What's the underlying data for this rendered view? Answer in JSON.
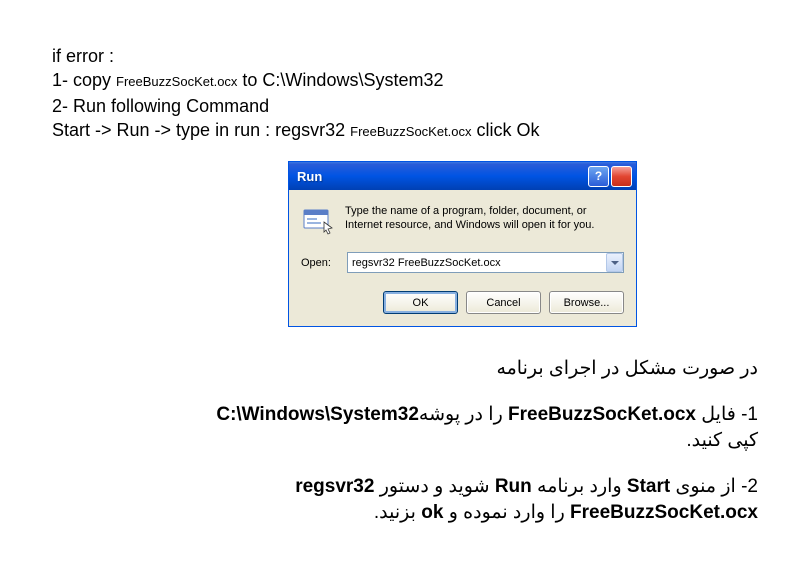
{
  "english": {
    "line1": "if error :",
    "line2a": "1- copy ",
    "line2b": "FreeBuzzSocKet.ocx",
    "line2c": " to  C:\\Windows\\System32",
    "line3": "2- Run following Command",
    "line4a": "Start -> Run -> type in run :  regsvr32 ",
    "line4b": "FreeBuzzSocKet.ocx",
    "line4c": "   click Ok"
  },
  "dialog": {
    "title": "Run",
    "description": "Type the name of a program, folder, document, or Internet resource, and Windows will open it for you.",
    "open_label": "Open:",
    "input_value": "regsvr32  FreeBuzzSocKet.ocx",
    "ok_label": "OK",
    "cancel_label": "Cancel",
    "browse_label": "Browse..."
  },
  "farsi": {
    "p1": "در صورت مشکل در اجرای برنامه",
    "p2_a": "1- فایل ",
    "p2_file": "FreeBuzzSocKet.ocx",
    "p2_b": " را در پوشه",
    "p2_path": "C:\\Windows\\System32",
    "p2_c": " کپی کنید.",
    "p3_a": "2- از منوی ",
    "p3_start": "Start",
    "p3_b": " وارد برنامه ",
    "p3_run": "Run",
    "p3_c": " شوید و دستور ",
    "p3_cmd": "regsvr32 FreeBuzzSocKet.ocx",
    "p3_d": " را وارد نموده و ",
    "p3_ok": "ok",
    "p3_e": " بزنید."
  }
}
